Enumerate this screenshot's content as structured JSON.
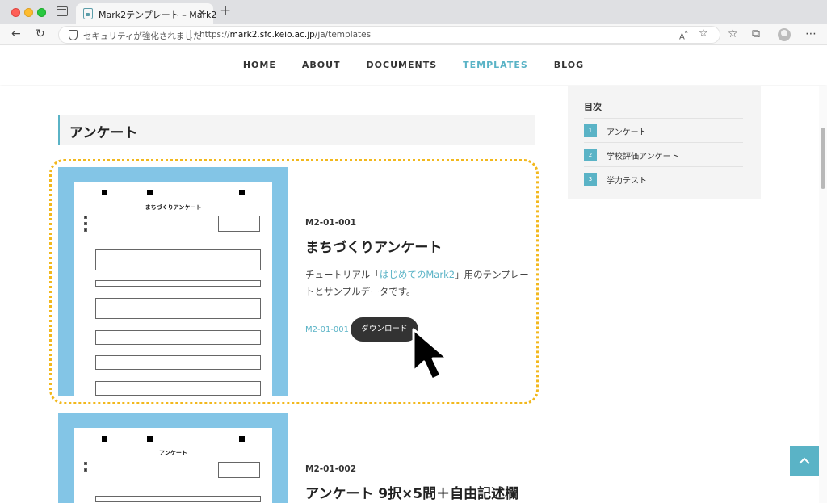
{
  "browser": {
    "tab_title": "Mark2テンプレート – Mark2",
    "security_text": "セキュリティが強化されました",
    "url_prefix": "https://",
    "url_host": "mark2.sfc.keio.ac.jp",
    "url_path": "/ja/templates"
  },
  "nav": {
    "items": [
      {
        "label": "HOME"
      },
      {
        "label": "ABOUT"
      },
      {
        "label": "DOCUMENTS"
      },
      {
        "label": "TEMPLATES",
        "active": true
      },
      {
        "label": "BLOG"
      }
    ]
  },
  "section": {
    "title": "アンケート"
  },
  "templates": [
    {
      "code": "M2-01-001",
      "title": "まちづくりアンケート",
      "desc_before": "チュートリアル「",
      "desc_link": "はじめてのMark2",
      "desc_after": "」用のテンプレートとサンプルデータです。",
      "file_link": "M2-01-001",
      "download_label": "ダウンロード",
      "sheet_title": "まちづくりアンケート"
    },
    {
      "code": "M2-01-002",
      "title": "アンケート 9択×5問＋自由記述欄",
      "sheet_title": "アンケート"
    }
  ],
  "toc": {
    "title": "目次",
    "items": [
      {
        "num": "1",
        "label": "アンケート"
      },
      {
        "num": "2",
        "label": "学校評価アンケート"
      },
      {
        "num": "3",
        "label": "学力テスト"
      }
    ]
  },
  "colors": {
    "accent": "#5ab3c6",
    "highlight": "#f2b81d",
    "thumb_bg": "#83c5e6",
    "button_bg": "#333333"
  }
}
